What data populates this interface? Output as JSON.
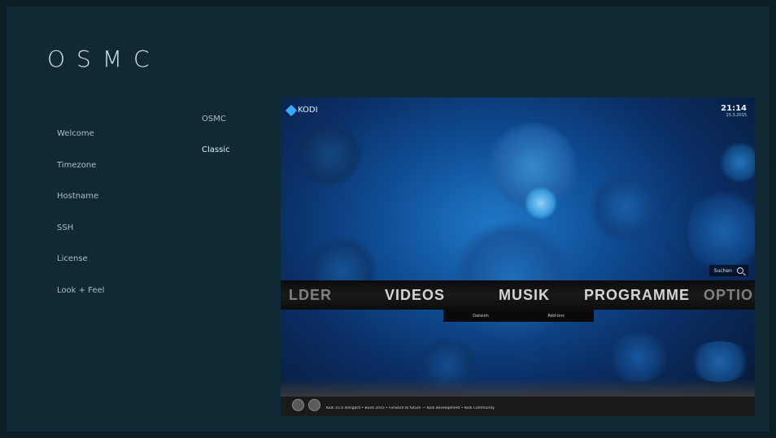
{
  "app": {
    "logo": "OSMC"
  },
  "sidebar": {
    "items": [
      {
        "label": "Welcome"
      },
      {
        "label": "Timezone"
      },
      {
        "label": "Hostname"
      },
      {
        "label": "SSH"
      },
      {
        "label": "License"
      },
      {
        "label": "Look + Feel"
      }
    ]
  },
  "skins": {
    "options": [
      {
        "label": "OSMC"
      },
      {
        "label": "Classic"
      }
    ],
    "selected": "Classic"
  },
  "preview": {
    "brand": "KODI",
    "time": "21:14",
    "date": "15.3.2015",
    "search_label": "Suchen",
    "menu": [
      "LDER",
      "VIDEOS",
      "MUSIK",
      "PROGRAMME",
      "OPTIO"
    ],
    "submenu": [
      "Dateien",
      "Add-ons"
    ],
    "ticker": "Kodi 15.0 Isengard • Build 2015 • Forward to future — Kodi development • Kodi Community"
  },
  "colors": {
    "background": "#0f2a34",
    "frame": "#0b1d25",
    "text": "#a7c0c8",
    "accent": "#39a9ff"
  }
}
